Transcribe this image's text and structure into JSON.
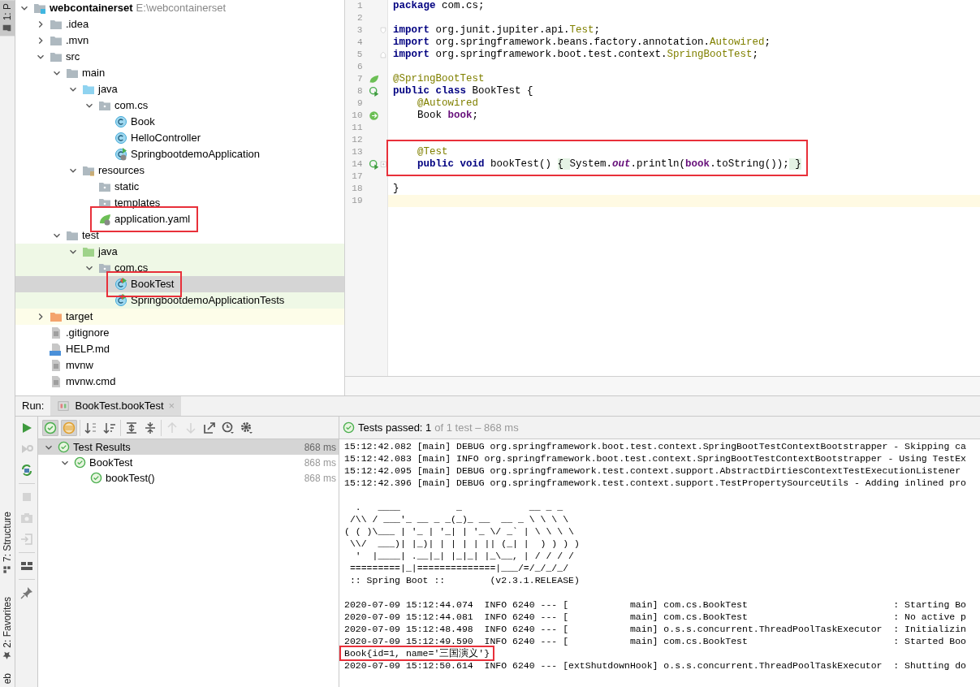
{
  "side_tabs": [
    {
      "label": "1: P",
      "kind": "project",
      "selected": true
    },
    {
      "label": "7: Structure",
      "kind": "structure",
      "selected": false
    },
    {
      "label": "2: Favorites",
      "kind": "favorites",
      "selected": false
    },
    {
      "label": "eb",
      "kind": "web",
      "selected": false
    }
  ],
  "project_tree": [
    {
      "label": "webcontainerset",
      "path": "E:\\webcontainerset",
      "kind": "module",
      "expanded": true,
      "selected": false,
      "children": [
        {
          "label": ".idea",
          "kind": "folder",
          "expanded": false,
          "selected": false
        },
        {
          "label": ".mvn",
          "kind": "folder",
          "expanded": false,
          "selected": false
        },
        {
          "label": "src",
          "kind": "folder",
          "expanded": true,
          "selected": false,
          "children": [
            {
              "label": "main",
              "kind": "folder",
              "expanded": true,
              "selected": false,
              "children": [
                {
                  "label": "java",
                  "kind": "source-folder",
                  "expanded": true,
                  "selected": false,
                  "children": [
                    {
                      "label": "com.cs",
                      "kind": "package",
                      "expanded": true,
                      "selected": false,
                      "children": [
                        {
                          "label": "Book",
                          "kind": "class",
                          "selected": false
                        },
                        {
                          "label": "HelloController",
                          "kind": "class",
                          "selected": false
                        },
                        {
                          "label": "SpringbootdemoApplication",
                          "kind": "spring-class",
                          "selected": false
                        }
                      ]
                    }
                  ]
                },
                {
                  "label": "resources",
                  "kind": "resources-folder",
                  "expanded": true,
                  "selected": false,
                  "children": [
                    {
                      "label": "static",
                      "kind": "package",
                      "selected": false
                    },
                    {
                      "label": "templates",
                      "kind": "package",
                      "selected": false
                    },
                    {
                      "label": "application.yaml",
                      "kind": "spring-config",
                      "selected": false,
                      "highlighted": true
                    }
                  ]
                }
              ]
            },
            {
              "label": "test",
              "kind": "folder",
              "expanded": true,
              "selected": false,
              "children": [
                {
                  "label": "java",
                  "kind": "test-folder",
                  "expanded": true,
                  "selected": false,
                  "in_test_scope": true,
                  "children": [
                    {
                      "label": "com.cs",
                      "kind": "package",
                      "expanded": true,
                      "selected": false,
                      "in_test_scope": true,
                      "children": [
                        {
                          "label": "BookTest",
                          "kind": "test-class",
                          "selected": true,
                          "highlighted": true
                        },
                        {
                          "label": "SpringbootdemoApplicationTests",
                          "kind": "test-class",
                          "selected": false,
                          "in_test_scope": true
                        }
                      ]
                    }
                  ]
                }
              ]
            }
          ]
        },
        {
          "label": "target",
          "kind": "excluded-folder",
          "expanded": false,
          "selected": false,
          "excluded": true
        },
        {
          "label": ".gitignore",
          "kind": "text-file",
          "selected": false
        },
        {
          "label": "HELP.md",
          "kind": "md-file",
          "selected": false
        },
        {
          "label": "mvnw",
          "kind": "text-file",
          "selected": false
        },
        {
          "label": "mvnw.cmd",
          "kind": "text-file",
          "selected": false
        }
      ]
    }
  ],
  "editor": {
    "lines": [
      {
        "number": "1",
        "tokens": [
          {
            "text": "package",
            "kind": "keyword"
          },
          {
            "text": " com.cs;",
            "kind": "plain"
          }
        ]
      },
      {
        "number": "2"
      },
      {
        "number": "3",
        "fold": {
          "kind": "start"
        },
        "tokens": [
          {
            "text": "import",
            "kind": "keyword"
          },
          {
            "text": " org.junit.jupiter.api.",
            "kind": "plain"
          },
          {
            "text": "Test",
            "kind": "annotation"
          },
          {
            "text": ";",
            "kind": "plain"
          }
        ]
      },
      {
        "number": "4",
        "tokens": [
          {
            "text": "import",
            "kind": "keyword"
          },
          {
            "text": " org.springframework.beans.factory.annotation.",
            "kind": "plain"
          },
          {
            "text": "Autowired",
            "kind": "annotation"
          },
          {
            "text": ";",
            "kind": "plain"
          }
        ]
      },
      {
        "number": "5",
        "fold": {
          "kind": "end"
        },
        "tokens": [
          {
            "text": "import",
            "kind": "keyword"
          },
          {
            "text": " org.springframework.boot.test.context.",
            "kind": "plain"
          },
          {
            "text": "SpringBootTest",
            "kind": "annotation"
          },
          {
            "text": ";",
            "kind": "plain"
          }
        ]
      },
      {
        "number": "6"
      },
      {
        "number": "7",
        "gutter": {
          "kind": "spring"
        },
        "tokens": [
          {
            "text": "@SpringBootTest",
            "kind": "annotation"
          }
        ]
      },
      {
        "number": "8",
        "gutter": {
          "kind": "run"
        },
        "tokens": [
          {
            "text": "public",
            "kind": "keyword"
          },
          {
            "text": " class",
            "kind": "keyword"
          },
          {
            "text": " BookTest {",
            "kind": "plain"
          }
        ]
      },
      {
        "number": "9",
        "tokens": [
          {
            "text": "    @Autowired",
            "kind": "annotation"
          }
        ]
      },
      {
        "number": "10",
        "gutter": {
          "kind": "bean"
        },
        "tokens": [
          {
            "text": "    Book ",
            "kind": "plain"
          },
          {
            "text": "book",
            "kind": "field"
          },
          {
            "text": ";",
            "kind": "plain"
          }
        ]
      },
      {
        "number": "11"
      },
      {
        "number": "12"
      },
      {
        "number": "13",
        "highlighted": true,
        "tokens": [
          {
            "text": "    @Test",
            "kind": "annotation"
          }
        ]
      },
      {
        "number": "14",
        "gutter": {
          "kind": "run"
        },
        "fold": {
          "kind": "collapsed"
        },
        "highlighted": true,
        "tokens": [
          {
            "text": "    public",
            "kind": "keyword"
          },
          {
            "text": " void",
            "kind": "keyword"
          },
          {
            "text": " bookTest() ",
            "kind": "plain"
          },
          {
            "text": "{ ",
            "kind": "folded"
          },
          {
            "text": "System.",
            "kind": "plain"
          },
          {
            "text": "out",
            "kind": "static"
          },
          {
            "text": ".println(",
            "kind": "plain"
          },
          {
            "text": "book",
            "kind": "field"
          },
          {
            "text": ".toString());",
            "kind": "plain"
          },
          {
            "text": " }",
            "kind": "folded"
          }
        ]
      },
      {
        "number": "17"
      },
      {
        "number": "18",
        "tokens": [
          {
            "text": "}",
            "kind": "plain"
          }
        ]
      },
      {
        "number": "19",
        "current": true
      }
    ]
  },
  "run_panel": {
    "label": "Run:",
    "tabs": [
      {
        "label": "BookTest.bookTest",
        "close": "×",
        "selected": true
      }
    ],
    "side_tools": [
      {
        "kind": "run",
        "disabled": false
      },
      {
        "kind": "rerun-failed",
        "disabled": true
      },
      {
        "kind": "auto-test",
        "disabled": false
      },
      {
        "kind": "separator"
      },
      {
        "kind": "stop",
        "disabled": true
      },
      {
        "kind": "camera",
        "disabled": true
      },
      {
        "kind": "import",
        "disabled": true
      },
      {
        "kind": "separator"
      },
      {
        "kind": "layout",
        "disabled": false
      },
      {
        "kind": "separator"
      },
      {
        "kind": "pin",
        "disabled": false
      }
    ],
    "tools": [
      {
        "kind": "show-passed",
        "selected": true,
        "disabled": false
      },
      {
        "kind": "show-ignored",
        "selected": true,
        "disabled": false
      },
      {
        "kind": "separator"
      },
      {
        "kind": "sort-alpha",
        "selected": false,
        "disabled": false
      },
      {
        "kind": "sort-duration",
        "selected": false,
        "disabled": false
      },
      {
        "kind": "separator"
      },
      {
        "kind": "expand-all",
        "selected": false,
        "disabled": false
      },
      {
        "kind": "collapse-all",
        "selected": false,
        "disabled": false
      },
      {
        "kind": "separator"
      },
      {
        "kind": "prev",
        "selected": false,
        "disabled": true
      },
      {
        "kind": "next",
        "selected": false,
        "disabled": true
      },
      {
        "kind": "export",
        "selected": false,
        "disabled": false
      },
      {
        "kind": "history",
        "selected": false,
        "disabled": false
      },
      {
        "kind": "settings",
        "selected": false,
        "disabled": false
      }
    ],
    "results": [
      {
        "label": "Test Results",
        "duration": "868 ms",
        "passed": true,
        "expanded": true,
        "selected": true,
        "children": [
          {
            "label": "BookTest",
            "duration": "868 ms",
            "passed": true,
            "expanded": true,
            "selected": false,
            "children": [
              {
                "label": "bookTest()",
                "duration": "868 ms",
                "passed": true,
                "selected": false
              }
            ]
          }
        ]
      }
    ],
    "summary": {
      "passed": true,
      "label": "Tests passed: 1",
      "detail": "of 1 test – 868 ms"
    },
    "console": [
      {
        "kind": "log",
        "text": "15:12:42.082 [main] DEBUG org.springframework.boot.test.context.SpringBootTestContextBootstrapper - Skipping ca"
      },
      {
        "kind": "log",
        "text": "15:12:42.083 [main] INFO org.springframework.boot.test.context.SpringBootTestContextBootstrapper - Using TestEx"
      },
      {
        "kind": "log",
        "text": "15:12:42.095 [main] DEBUG org.springframework.test.context.support.AbstractDirtiesContextTestExecutionListener"
      },
      {
        "kind": "log",
        "text": "15:12:42.396 [main] DEBUG org.springframework.test.context.support.TestPropertySourceUtils - Adding inlined pro"
      },
      {
        "kind": "blank"
      },
      {
        "kind": "log",
        "text": "  .   ____          _            __ _ _"
      },
      {
        "kind": "log",
        "text": " /\\\\ / ___'_ __ _ _(_)_ __  __ _ \\ \\ \\ \\"
      },
      {
        "kind": "log",
        "text": "( ( )\\___ | '_ | '_| | '_ \\/ _` | \\ \\ \\ \\"
      },
      {
        "kind": "log",
        "text": " \\\\/  ___)| |_)| | | | | || (_| |  ) ) ) )"
      },
      {
        "kind": "log",
        "text": "  '  |____| .__|_| |_|_| |_\\__, | / / / /"
      },
      {
        "kind": "log",
        "text": " =========|_|==============|___/=/_/_/_/"
      },
      {
        "kind": "log",
        "text": " :: Spring Boot ::        (v2.3.1.RELEASE)"
      },
      {
        "kind": "blank"
      },
      {
        "kind": "log",
        "text": "2020-07-09 15:12:44.074  INFO 6240 --- [           main] com.cs.BookTest                          : Starting Bo"
      },
      {
        "kind": "log",
        "text": "2020-07-09 15:12:44.081  INFO 6240 --- [           main] com.cs.BookTest                          : No active p"
      },
      {
        "kind": "log",
        "text": "2020-07-09 15:12:48.498  INFO 6240 --- [           main] o.s.s.concurrent.ThreadPoolTaskExecutor  : Initializin"
      },
      {
        "kind": "log",
        "text": "2020-07-09 15:12:49.590  INFO 6240 --- [           main] com.cs.BookTest                          : Started Boo"
      },
      {
        "kind": "log",
        "text": "Book{id=1, name='三国演义'}",
        "highlighted": true
      },
      {
        "kind": "log",
        "text": "2020-07-09 15:12:50.614  INFO 6240 --- [extShutdownHook] o.s.s.concurrent.ThreadPoolTaskExecutor  : Shutting do"
      }
    ]
  }
}
